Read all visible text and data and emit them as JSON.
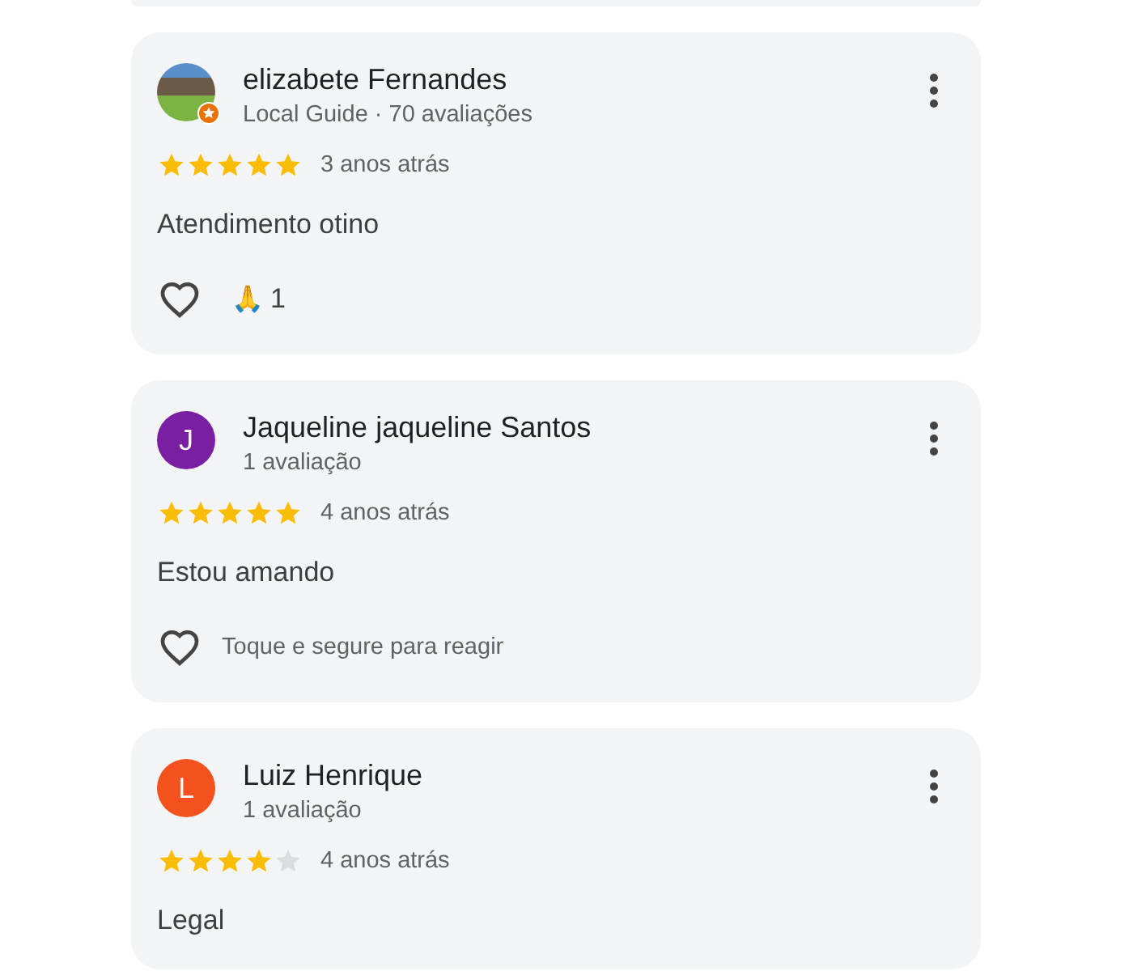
{
  "reviews": [
    {
      "name": "elizabete Fernandes",
      "avatar": {
        "kind": "photo",
        "local_guide": true
      },
      "meta": "Local Guide · 70 avaliações",
      "stars": 5,
      "time": "3 anos atrás",
      "text": "Atendimento otino",
      "reaction": {
        "kind": "count",
        "emoji": "🙏",
        "count": "1"
      }
    },
    {
      "name": "Jaqueline jaqueline Santos",
      "avatar": {
        "kind": "letter",
        "letter": "J",
        "color": "#7b1fa2"
      },
      "meta": "1 avaliação",
      "stars": 5,
      "time": "4 anos atrás",
      "text": "Estou amando",
      "reaction": {
        "kind": "hint",
        "hint": "Toque e segure para reagir"
      }
    },
    {
      "name": "Luiz Henrique",
      "avatar": {
        "kind": "letter",
        "letter": "L",
        "color": "#f4511e"
      },
      "meta": "1 avaliação",
      "stars": 4,
      "time": "4 anos atrás",
      "text": "Legal"
    }
  ]
}
